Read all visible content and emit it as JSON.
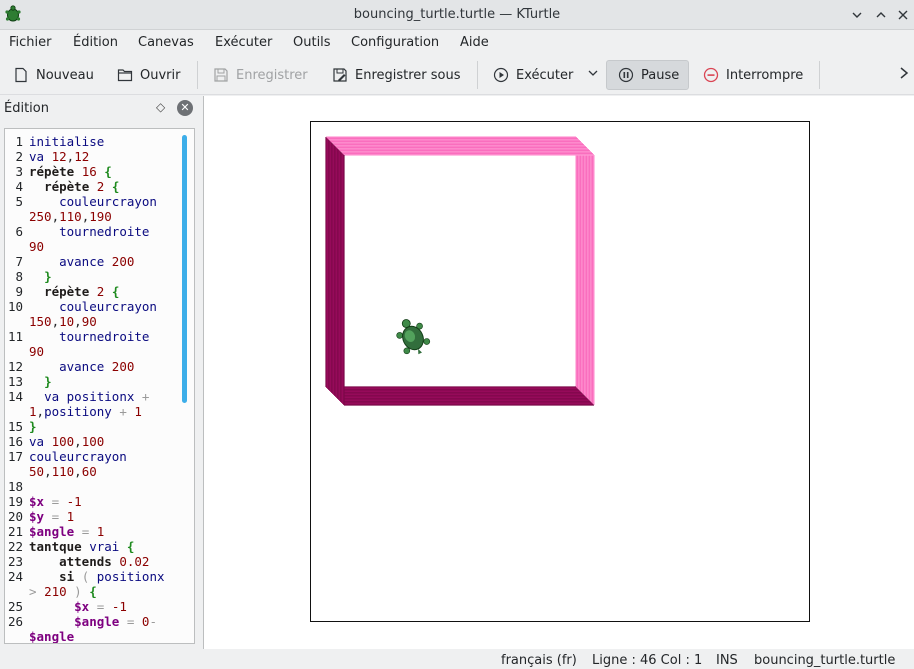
{
  "window": {
    "title": "bouncing_turtle.turtle — KTurtle"
  },
  "menu": [
    "Fichier",
    "Édition",
    "Canevas",
    "Exécuter",
    "Outils",
    "Configuration",
    "Aide"
  ],
  "toolbar": {
    "new_label": "Nouveau",
    "open_label": "Ouvrir",
    "save_label": "Enregistrer",
    "save_as_label": "Enregistrer sous",
    "run_label": "Exécuter",
    "pause_label": "Pause",
    "abort_label": "Interrompre"
  },
  "editor": {
    "title": "Édition",
    "lines": [
      {
        "n": "1",
        "text": "initialise"
      },
      {
        "n": "2",
        "text": "va 12,12"
      },
      {
        "n": "3",
        "text": "répète 16 {"
      },
      {
        "n": "4",
        "text": "  répète 2 {"
      },
      {
        "n": "5",
        "text": "    couleurcrayon"
      },
      {
        "n": "",
        "text": "250,110,190"
      },
      {
        "n": "6",
        "text": "    tournedroite"
      },
      {
        "n": "",
        "text": "90"
      },
      {
        "n": "7",
        "text": "    avance 200"
      },
      {
        "n": "8",
        "text": "  }"
      },
      {
        "n": "9",
        "text": "  répète 2 {"
      },
      {
        "n": "10",
        "text": "    couleurcrayon"
      },
      {
        "n": "",
        "text": "150,10,90"
      },
      {
        "n": "11",
        "text": "    tournedroite"
      },
      {
        "n": "",
        "text": "90"
      },
      {
        "n": "12",
        "text": "    avance 200"
      },
      {
        "n": "13",
        "text": "  }"
      },
      {
        "n": "14",
        "text": "  va positionx +"
      },
      {
        "n": "",
        "text": "1,positiony + 1"
      },
      {
        "n": "15",
        "text": "}"
      },
      {
        "n": "16",
        "text": "va 100,100"
      },
      {
        "n": "17",
        "text": "couleurcrayon"
      },
      {
        "n": "",
        "text": "50,110,60"
      },
      {
        "n": "18",
        "text": ""
      },
      {
        "n": "19",
        "text": "$x = -1"
      },
      {
        "n": "20",
        "text": "$y = 1"
      },
      {
        "n": "21",
        "text": "$angle = 1"
      },
      {
        "n": "22",
        "text": "tantque vrai {"
      },
      {
        "n": "23",
        "text": "    attends 0.02"
      },
      {
        "n": "24",
        "text": "    si ( positionx"
      },
      {
        "n": "",
        "text": "> 210 ) {"
      },
      {
        "n": "25",
        "text": "      $x = -1"
      },
      {
        "n": "26",
        "text": "      $angle = 0-"
      },
      {
        "n": "",
        "text": "$angle"
      }
    ]
  },
  "colors": {
    "pen_pink": "#fa6ebe",
    "pen_dark": "#960a5a",
    "turtle_green": "#326e3c",
    "accent": "#3daee9"
  },
  "status": {
    "language": "français (fr)",
    "position": "Ligne : 46 Col : 1",
    "mode": "INS",
    "file": "bouncing_turtle.turtle"
  }
}
